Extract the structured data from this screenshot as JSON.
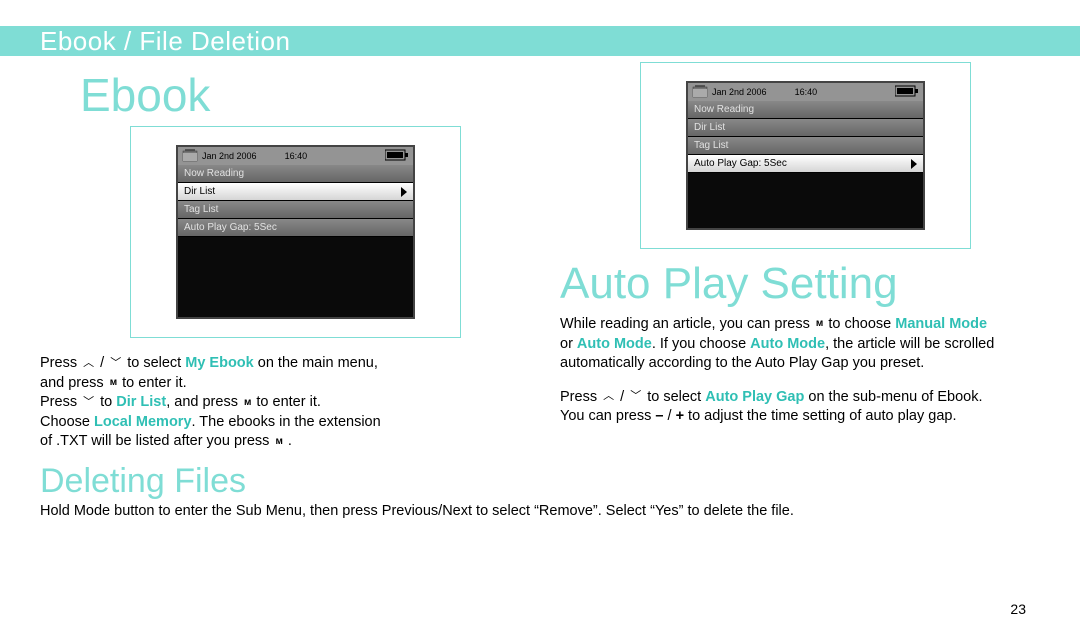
{
  "header": "Ebook / File Deletion",
  "left": {
    "title": "Ebook",
    "screen": {
      "date": "Jan 2nd 2006",
      "time": "16:40",
      "rows": [
        {
          "label": "Now Reading",
          "sel": false
        },
        {
          "label": "Dir List",
          "sel": true
        },
        {
          "label": "Tag List",
          "sel": false
        },
        {
          "label": "Auto Play Gap: 5Sec",
          "sel": false
        }
      ]
    },
    "para": {
      "p1a": "Press ",
      "p1_ic1": "up",
      "p1b": " / ",
      "p1_ic2": "down",
      "p1c": " to select ",
      "p1_hl": "My Ebook",
      "p1d": " on the main menu,",
      "p2a": "and press ",
      "p2_ic": "m",
      "p2b": " to enter it.",
      "p3a": "Press ",
      "p3_ic": "down",
      "p3b": " to ",
      "p3_hl": "Dir List",
      "p3c": ", and press ",
      "p3_ic2": "m",
      "p3d": " to enter it.",
      "p4a": "Choose ",
      "p4_hl": "Local Memory",
      "p4b": ". The ebooks in the extension",
      "p5a": "of .TXT will be listed after you press ",
      "p5_ic": "m",
      "p5b": " ."
    }
  },
  "right": {
    "title": "Auto Play Setting",
    "screen": {
      "date": "Jan 2nd 2006",
      "time": "16:40",
      "rows": [
        {
          "label": "Now Reading",
          "sel": false
        },
        {
          "label": "Dir List",
          "sel": false
        },
        {
          "label": "Tag List",
          "sel": false
        },
        {
          "label": "Auto Play Gap: 5Sec",
          "sel": true
        }
      ]
    },
    "para": {
      "p1a": "While reading an article, you can press ",
      "p1_ic": "m",
      "p1b": " to choose ",
      "p1_hl": "Manual Mode",
      "p2a": "or ",
      "p2_hl": "Auto Mode",
      "p2b": ". If you choose ",
      "p2_hl2": "Auto Mode",
      "p2c": ", the article will be scrolled",
      "p3": "automatically according to the Auto Play Gap you preset.",
      "p4a": "Press ",
      "p4_ic1": "up",
      "p4b": " / ",
      "p4_ic2": "down",
      "p4c": " to select ",
      "p4_hl": "Auto Play Gap",
      "p4d": " on the sub-menu of Ebook.",
      "p5a": "You can press ",
      "p5_m": "–",
      "p5b": " / ",
      "p5_p": "+",
      "p5c": " to adjust the time setting of auto play gap."
    }
  },
  "deleting": {
    "title": "Deleting Files",
    "text": "Hold Mode button to enter the Sub Menu, then press Previous/Next to select “Remove”. Select “Yes” to delete the file."
  },
  "page": "23"
}
